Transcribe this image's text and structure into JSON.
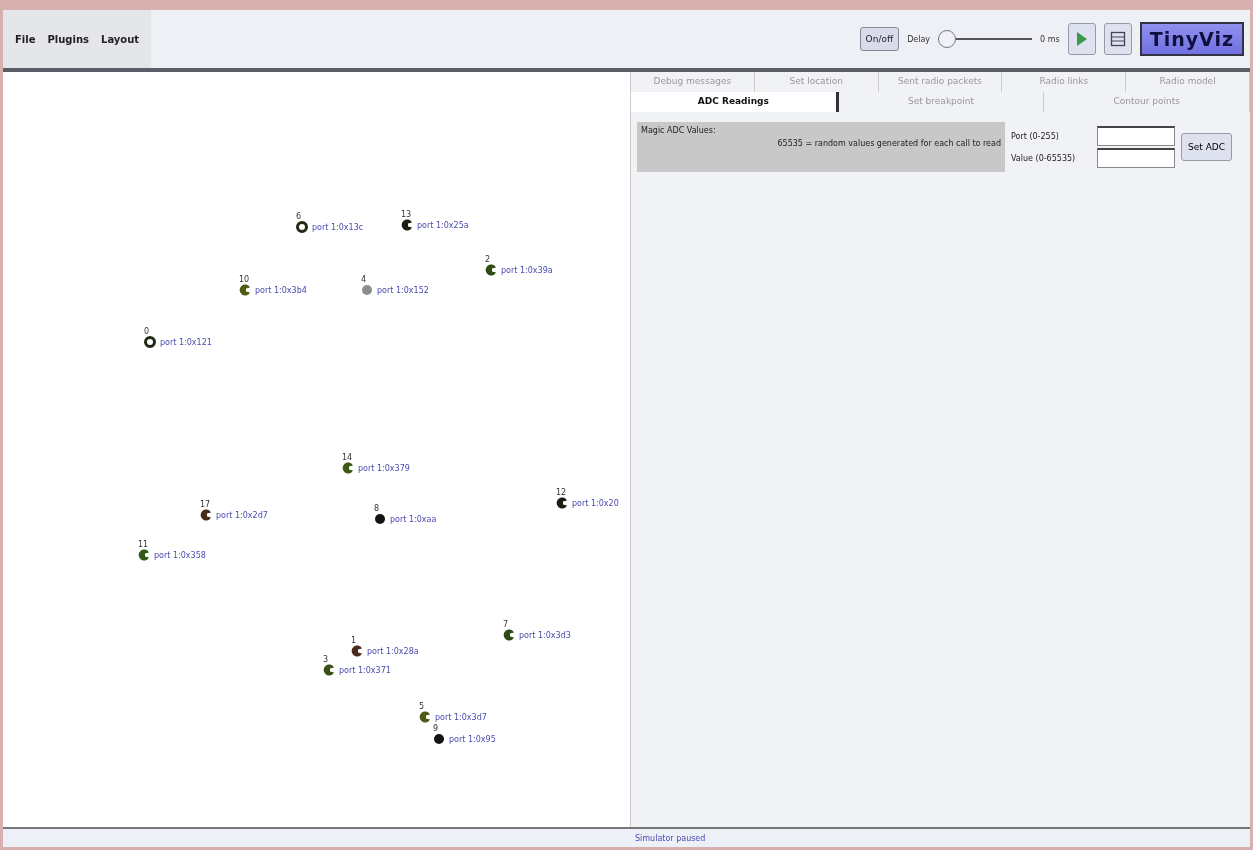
{
  "menu": [
    "File",
    "Plugins",
    "Layout"
  ],
  "toolbar": {
    "power_button": "On/off",
    "delay_label": "Delay",
    "delay": {
      "level": 0
    },
    "delay_reading": "0 ms",
    "logo": "TinyViz"
  },
  "motes": [
    {
      "id": "6",
      "label": "port 1:0x13c",
      "kind": "ring",
      "color": "#1f2a14"
    },
    {
      "id": "13",
      "label": "port 1:0x25a",
      "kind": "c",
      "color": "#1c1c10"
    },
    {
      "id": "2",
      "label": "port 1:0x39a",
      "kind": "c",
      "color": "#2f4a12"
    },
    {
      "id": "10",
      "label": "port 1:0x3b4",
      "kind": "c",
      "color": "#4f5a12"
    },
    {
      "id": "4",
      "label": "port 1:0x152",
      "kind": "dot",
      "color": "#8a9088"
    },
    {
      "id": "0",
      "label": "port 1:0x121",
      "kind": "ring",
      "color": "#1f2a14"
    },
    {
      "id": "14",
      "label": "port 1:0x379",
      "kind": "c",
      "color": "#3a5a14"
    },
    {
      "id": "17",
      "label": "port 1:0x2d7",
      "kind": "c",
      "color": "#4a2a18"
    },
    {
      "id": "8",
      "label": "port 1:0xaa",
      "kind": "dot",
      "color": "#141414"
    },
    {
      "id": "12",
      "label": "port 1:0x20",
      "kind": "c",
      "color": "#1c1c10"
    },
    {
      "id": "11",
      "label": "port 1:0x358",
      "kind": "c",
      "color": "#2f5a14"
    },
    {
      "id": "1",
      "label": "port 1:0x28a",
      "kind": "c",
      "color": "#4a2a18"
    },
    {
      "id": "3",
      "label": "port 1:0x371",
      "kind": "c",
      "color": "#3a5014"
    },
    {
      "id": "7",
      "label": "port 1:0x3d3",
      "kind": "c",
      "color": "#2f4a14"
    },
    {
      "id": "5",
      "label": "port 1:0x3d7",
      "kind": "c",
      "color": "#4f5a14"
    },
    {
      "id": "9",
      "label": "port 1:0x95",
      "kind": "dot",
      "color": "#141414"
    }
  ],
  "tabs": [
    [
      {
        "label": "Debug messages",
        "selected": false
      },
      {
        "label": "Set location",
        "selected": false
      },
      {
        "label": "Sent radio packets",
        "selected": false
      },
      {
        "label": "Radio links",
        "selected": false
      },
      {
        "label": "Radio model",
        "selected": false
      }
    ],
    [
      {
        "label": "ADC Readings",
        "selected": true
      },
      {
        "label": "Set breakpoint",
        "selected": false
      },
      {
        "label": "Contour points",
        "selected": false
      }
    ]
  ],
  "adc": {
    "title": "Magic ADC Values:",
    "note": "65535 = random values generated for each call to read",
    "port_label": "Port (0-255)",
    "value_label": "Value (0-65535)",
    "button": "Set ADC"
  },
  "status_bar": "Simulator paused"
}
